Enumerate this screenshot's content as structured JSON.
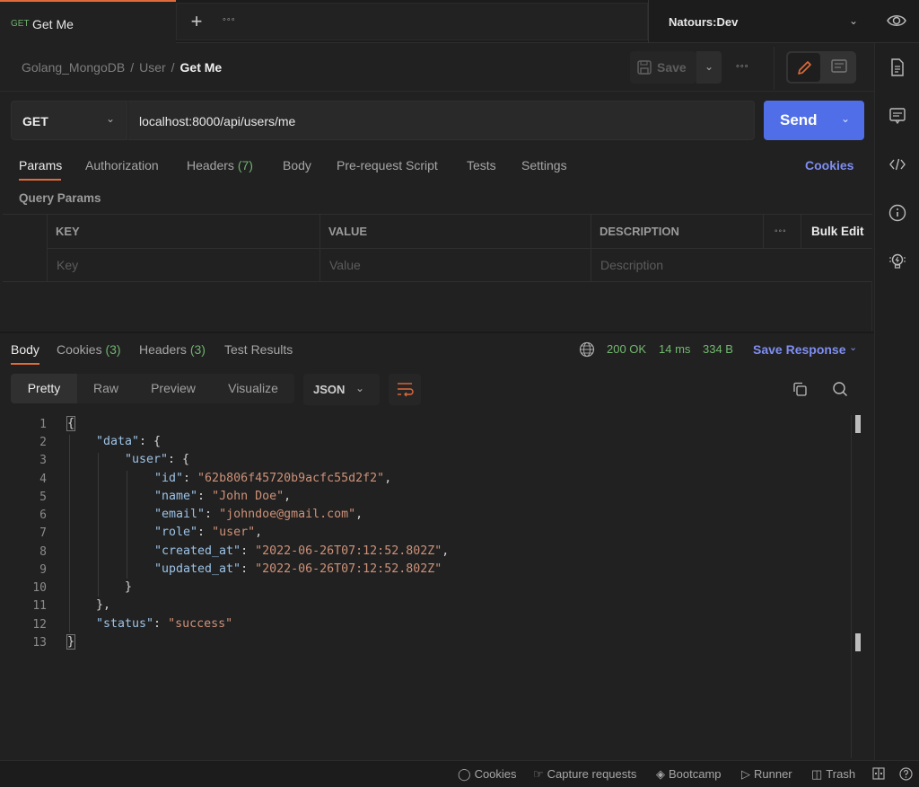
{
  "tabs": {
    "active": {
      "method": "GET",
      "title": "Get Me"
    },
    "new_tab_icon": "plus-icon",
    "more_icon": "more-horizontal-icon"
  },
  "environment": {
    "selected": "Natours:Dev"
  },
  "breadcrumb": {
    "items": [
      "Golang_MongoDB",
      "User"
    ],
    "current": "Get Me",
    "separator": "/"
  },
  "toolbar": {
    "save_label": "Save"
  },
  "request": {
    "method": "GET",
    "url": "localhost:8000/api/users/me",
    "send_label": "Send"
  },
  "request_tabs": [
    {
      "label": "Params",
      "active": true
    },
    {
      "label": "Authorization"
    },
    {
      "label": "Headers",
      "count": "(7)"
    },
    {
      "label": "Body"
    },
    {
      "label": "Pre-request Script"
    },
    {
      "label": "Tests"
    },
    {
      "label": "Settings"
    }
  ],
  "cookies_link": "Cookies",
  "query_params": {
    "title": "Query Params",
    "headers": [
      "KEY",
      "VALUE",
      "DESCRIPTION"
    ],
    "bulk_edit": "Bulk Edit",
    "placeholders": [
      "Key",
      "Value",
      "Description"
    ]
  },
  "response_tabs": [
    {
      "label": "Body",
      "active": true
    },
    {
      "label": "Cookies",
      "count": "(3)"
    },
    {
      "label": "Headers",
      "count": "(3)"
    },
    {
      "label": "Test Results"
    }
  ],
  "response_meta": {
    "status": "200 OK",
    "time": "14 ms",
    "size": "334 B",
    "save_response": "Save Response",
    "status_color": "#73b96f"
  },
  "view_modes": [
    "Pretty",
    "Raw",
    "Preview",
    "Visualize"
  ],
  "active_view_mode": "Pretty",
  "format": "JSON",
  "response_body": {
    "line_numbers": [
      "1",
      "2",
      "3",
      "4",
      "5",
      "6",
      "7",
      "8",
      "9",
      "10",
      "11",
      "12",
      "13"
    ],
    "fields": {
      "data_key": "\"data\"",
      "user_key": "\"user\"",
      "id_key": "\"id\"",
      "id_val": "\"62b806f45720b9acfc55d2f2\"",
      "name_key": "\"name\"",
      "name_val": "\"John Doe\"",
      "email_key": "\"email\"",
      "email_val": "\"johndoe@gmail.com\"",
      "role_key": "\"role\"",
      "role_val": "\"user\"",
      "created_key": "\"created_at\"",
      "created_val": "\"2022-06-26T07:12:52.802Z\"",
      "updated_key": "\"updated_at\"",
      "updated_val": "\"2022-06-26T07:12:52.802Z\"",
      "status_key": "\"status\"",
      "status_val": "\"success\""
    }
  },
  "footer": {
    "items": [
      "Cookies",
      "Capture requests",
      "Bootcamp",
      "Runner",
      "Trash"
    ]
  },
  "colors": {
    "accent_orange": "#e06a3a",
    "send_blue": "#4f6ee8",
    "link_blue": "#7f8ef0",
    "success_green": "#73b96f"
  }
}
